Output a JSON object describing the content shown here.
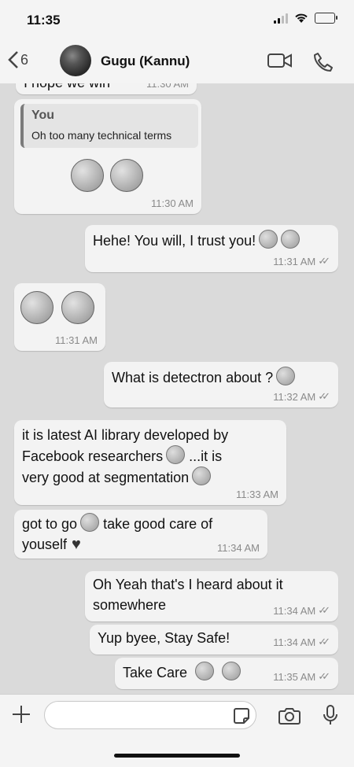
{
  "status": {
    "time": "11:35"
  },
  "header": {
    "back_count": "6",
    "contact_name": "Gugu (Kannu)"
  },
  "messages": [
    {
      "text": "I hope we win",
      "time": "11:30 AM",
      "direction": "in"
    },
    {
      "quote_name": "You",
      "quote_text": "Oh too many technical terms",
      "time": "11:30 AM",
      "direction": "in"
    },
    {
      "text": "Hehe! You will, I trust you!",
      "time": "11:31 AM",
      "direction": "out"
    },
    {
      "time": "11:31 AM",
      "direction": "in"
    },
    {
      "text": "What is detectron about ?",
      "time": "11:32 AM",
      "direction": "out"
    },
    {
      "line1": "it is latest AI library developed by",
      "line2": "Facebook researchers",
      "line2b": "...it is",
      "line3": "very good at segmentation",
      "time": "11:33 AM",
      "direction": "in"
    },
    {
      "line1": "got to go",
      "line1b": "take good care of",
      "line2": "youself",
      "time": "11:34 AM",
      "direction": "in"
    },
    {
      "line1": "Oh Yeah that's I heard about it",
      "line2": "somewhere",
      "time": "11:34 AM",
      "direction": "out"
    },
    {
      "text": "Yup byee, Stay Safe!",
      "time": "11:34 AM",
      "direction": "out"
    },
    {
      "text": "Take Care",
      "time": "11:35 AM",
      "direction": "out"
    }
  ],
  "composer": {
    "placeholder": ""
  },
  "icons": [
    "back-chevron-icon",
    "video-call-icon",
    "phone-icon",
    "plus-icon",
    "sticker-icon",
    "camera-icon",
    "mic-icon"
  ]
}
